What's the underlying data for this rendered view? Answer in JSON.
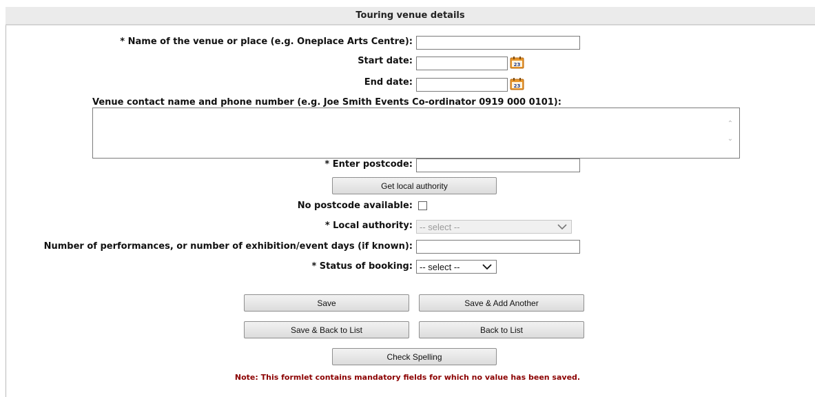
{
  "header": {
    "title": "Touring venue details"
  },
  "form": {
    "venue_name_label": "* Name of the venue or place (e.g. Oneplace Arts Centre):",
    "venue_name_value": "",
    "start_date_label": "Start date:",
    "start_date_value": "",
    "end_date_label": "End date:",
    "end_date_value": "",
    "calendar_icon_text": "23",
    "contact_label": "Venue contact name and phone number (e.g. Joe Smith Events Co-ordinator 0919 000 0101):",
    "contact_value": "",
    "postcode_label": "* Enter postcode:",
    "postcode_value": "",
    "get_local_authority_label": "Get local authority",
    "no_postcode_label": "No postcode available:",
    "no_postcode_checked": false,
    "local_authority_label": "* Local authority:",
    "local_authority_value": "-- select --",
    "performances_label": "Number of performances, or number of exhibition/event days (if known):",
    "performances_value": "",
    "status_label": "* Status of booking:",
    "status_value": "-- select --"
  },
  "buttons": {
    "save": "Save",
    "save_add_another": "Save & Add Another",
    "save_back_to_list": "Save & Back to List",
    "back_to_list": "Back to List",
    "check_spelling": "Check Spelling"
  },
  "note": "Note: This formlet contains mandatory fields for which no value has been saved.",
  "colors": {
    "calendar_orange": "#e8962a",
    "note_text": "#8b0000",
    "header_bg": "#ebebeb"
  }
}
